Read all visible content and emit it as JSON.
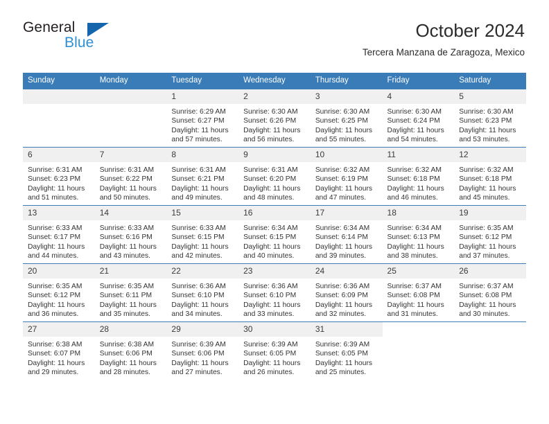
{
  "brand": {
    "name_top": "General",
    "name_bottom": "Blue",
    "triangle_color": "#1565ad",
    "blue_color": "#2d8fd5"
  },
  "header": {
    "title": "October 2024",
    "subtitle": "Tercera Manzana de Zaragoza, Mexico"
  },
  "theme": {
    "header_bg": "#3a7cb8",
    "daynum_bg": "#f0f0f0",
    "text": "#333333"
  },
  "calendar": {
    "weekday_headers": [
      "Sunday",
      "Monday",
      "Tuesday",
      "Wednesday",
      "Thursday",
      "Friday",
      "Saturday"
    ],
    "labels": {
      "sunrise": "Sunrise:",
      "sunset": "Sunset:",
      "daylight": "Daylight:"
    },
    "weeks": [
      [
        {
          "day": "",
          "empty": true
        },
        {
          "day": "",
          "empty": true
        },
        {
          "day": "1",
          "sunrise": "Sunrise: 6:29 AM",
          "sunset": "Sunset: 6:27 PM",
          "daylight": "Daylight: 11 hours and 57 minutes."
        },
        {
          "day": "2",
          "sunrise": "Sunrise: 6:30 AM",
          "sunset": "Sunset: 6:26 PM",
          "daylight": "Daylight: 11 hours and 56 minutes."
        },
        {
          "day": "3",
          "sunrise": "Sunrise: 6:30 AM",
          "sunset": "Sunset: 6:25 PM",
          "daylight": "Daylight: 11 hours and 55 minutes."
        },
        {
          "day": "4",
          "sunrise": "Sunrise: 6:30 AM",
          "sunset": "Sunset: 6:24 PM",
          "daylight": "Daylight: 11 hours and 54 minutes."
        },
        {
          "day": "5",
          "sunrise": "Sunrise: 6:30 AM",
          "sunset": "Sunset: 6:23 PM",
          "daylight": "Daylight: 11 hours and 53 minutes."
        }
      ],
      [
        {
          "day": "6",
          "sunrise": "Sunrise: 6:31 AM",
          "sunset": "Sunset: 6:23 PM",
          "daylight": "Daylight: 11 hours and 51 minutes."
        },
        {
          "day": "7",
          "sunrise": "Sunrise: 6:31 AM",
          "sunset": "Sunset: 6:22 PM",
          "daylight": "Daylight: 11 hours and 50 minutes."
        },
        {
          "day": "8",
          "sunrise": "Sunrise: 6:31 AM",
          "sunset": "Sunset: 6:21 PM",
          "daylight": "Daylight: 11 hours and 49 minutes."
        },
        {
          "day": "9",
          "sunrise": "Sunrise: 6:31 AM",
          "sunset": "Sunset: 6:20 PM",
          "daylight": "Daylight: 11 hours and 48 minutes."
        },
        {
          "day": "10",
          "sunrise": "Sunrise: 6:32 AM",
          "sunset": "Sunset: 6:19 PM",
          "daylight": "Daylight: 11 hours and 47 minutes."
        },
        {
          "day": "11",
          "sunrise": "Sunrise: 6:32 AM",
          "sunset": "Sunset: 6:18 PM",
          "daylight": "Daylight: 11 hours and 46 minutes."
        },
        {
          "day": "12",
          "sunrise": "Sunrise: 6:32 AM",
          "sunset": "Sunset: 6:18 PM",
          "daylight": "Daylight: 11 hours and 45 minutes."
        }
      ],
      [
        {
          "day": "13",
          "sunrise": "Sunrise: 6:33 AM",
          "sunset": "Sunset: 6:17 PM",
          "daylight": "Daylight: 11 hours and 44 minutes."
        },
        {
          "day": "14",
          "sunrise": "Sunrise: 6:33 AM",
          "sunset": "Sunset: 6:16 PM",
          "daylight": "Daylight: 11 hours and 43 minutes."
        },
        {
          "day": "15",
          "sunrise": "Sunrise: 6:33 AM",
          "sunset": "Sunset: 6:15 PM",
          "daylight": "Daylight: 11 hours and 42 minutes."
        },
        {
          "day": "16",
          "sunrise": "Sunrise: 6:34 AM",
          "sunset": "Sunset: 6:15 PM",
          "daylight": "Daylight: 11 hours and 40 minutes."
        },
        {
          "day": "17",
          "sunrise": "Sunrise: 6:34 AM",
          "sunset": "Sunset: 6:14 PM",
          "daylight": "Daylight: 11 hours and 39 minutes."
        },
        {
          "day": "18",
          "sunrise": "Sunrise: 6:34 AM",
          "sunset": "Sunset: 6:13 PM",
          "daylight": "Daylight: 11 hours and 38 minutes."
        },
        {
          "day": "19",
          "sunrise": "Sunrise: 6:35 AM",
          "sunset": "Sunset: 6:12 PM",
          "daylight": "Daylight: 11 hours and 37 minutes."
        }
      ],
      [
        {
          "day": "20",
          "sunrise": "Sunrise: 6:35 AM",
          "sunset": "Sunset: 6:12 PM",
          "daylight": "Daylight: 11 hours and 36 minutes."
        },
        {
          "day": "21",
          "sunrise": "Sunrise: 6:35 AM",
          "sunset": "Sunset: 6:11 PM",
          "daylight": "Daylight: 11 hours and 35 minutes."
        },
        {
          "day": "22",
          "sunrise": "Sunrise: 6:36 AM",
          "sunset": "Sunset: 6:10 PM",
          "daylight": "Daylight: 11 hours and 34 minutes."
        },
        {
          "day": "23",
          "sunrise": "Sunrise: 6:36 AM",
          "sunset": "Sunset: 6:10 PM",
          "daylight": "Daylight: 11 hours and 33 minutes."
        },
        {
          "day": "24",
          "sunrise": "Sunrise: 6:36 AM",
          "sunset": "Sunset: 6:09 PM",
          "daylight": "Daylight: 11 hours and 32 minutes."
        },
        {
          "day": "25",
          "sunrise": "Sunrise: 6:37 AM",
          "sunset": "Sunset: 6:08 PM",
          "daylight": "Daylight: 11 hours and 31 minutes."
        },
        {
          "day": "26",
          "sunrise": "Sunrise: 6:37 AM",
          "sunset": "Sunset: 6:08 PM",
          "daylight": "Daylight: 11 hours and 30 minutes."
        }
      ],
      [
        {
          "day": "27",
          "sunrise": "Sunrise: 6:38 AM",
          "sunset": "Sunset: 6:07 PM",
          "daylight": "Daylight: 11 hours and 29 minutes."
        },
        {
          "day": "28",
          "sunrise": "Sunrise: 6:38 AM",
          "sunset": "Sunset: 6:06 PM",
          "daylight": "Daylight: 11 hours and 28 minutes."
        },
        {
          "day": "29",
          "sunrise": "Sunrise: 6:39 AM",
          "sunset": "Sunset: 6:06 PM",
          "daylight": "Daylight: 11 hours and 27 minutes."
        },
        {
          "day": "30",
          "sunrise": "Sunrise: 6:39 AM",
          "sunset": "Sunset: 6:05 PM",
          "daylight": "Daylight: 11 hours and 26 minutes."
        },
        {
          "day": "31",
          "sunrise": "Sunrise: 6:39 AM",
          "sunset": "Sunset: 6:05 PM",
          "daylight": "Daylight: 11 hours and 25 minutes."
        },
        {
          "day": "",
          "blank": true
        },
        {
          "day": "",
          "blank": true
        }
      ]
    ]
  }
}
